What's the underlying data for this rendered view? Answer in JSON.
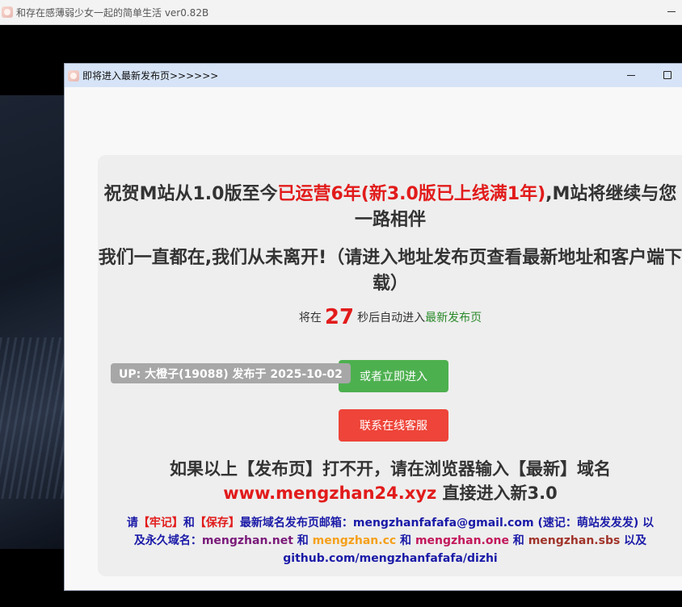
{
  "bg_window": {
    "title": "和存在感薄弱少女一起的简单生活 ver0.82B"
  },
  "popup": {
    "title": "即将进入最新发布页>>>>>>",
    "headline1": {
      "pre": "祝贺M站从1.0版至今",
      "highlight": "已运营6年(新3.0版已上线满1年)",
      "post": ",M站将继续与您一路相伴"
    },
    "headline2": "我们一直都在,我们从未离开!（请进入地址发布页查看最新地址和客户端下载）",
    "countdown": {
      "pre": "将在",
      "seconds": "27",
      "mid": "秒后自动进入",
      "link": "最新发布页"
    },
    "enter_button": "或者立即进入",
    "service_button": "联系在线客服",
    "up_badge": "UP: 大橙子(19088) 发布于 2025-10-02",
    "info1": {
      "line1": "如果以上【发布页】打不开，请在浏览器输入【最新】域名",
      "url": "www.mengzhan24.xyz",
      "post": " 直接进入新3.0"
    },
    "info2": {
      "p1": "请",
      "p2": "【牢记】",
      "p3": "和",
      "p4": "【保存】",
      "p5": "最新域名发布页邮箱：mengzhanfafafa@gmail.com (速记：萌站发发发) 以及永久域名：",
      "d1": "mengzhan.net",
      "p6": " 和 ",
      "d2": "mengzhan.cc",
      "p7": " 和 ",
      "d3": "mengzhan.one",
      "p8": " 和 ",
      "d4": "mengzhan.sbs",
      "p9": " 以及 github.com/mengzhanfafafa/dizhi"
    }
  }
}
